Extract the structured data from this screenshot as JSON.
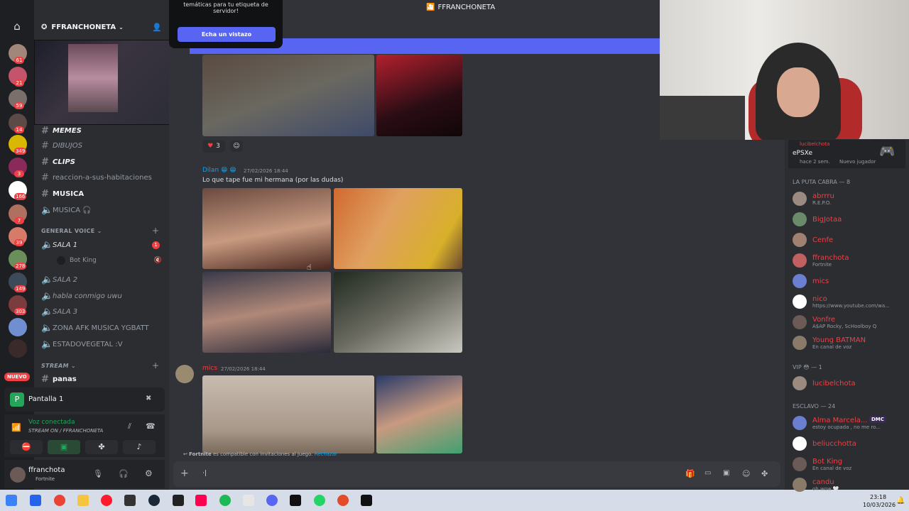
{
  "titlebar": {
    "title": "FFRANCHONETA"
  },
  "banner_popup": {
    "text": "temáticas para tu etiqueta de servidor!",
    "button": "Echa un vistazo"
  },
  "server": {
    "name": "FFRANCHONETA"
  },
  "rail_badges": [
    "61",
    "21",
    "59",
    "14",
    "349",
    "3",
    "166",
    "7",
    "39",
    "278",
    "149",
    "303"
  ],
  "channels": {
    "memes": "MEMES",
    "dibujos": "DIBUJOS",
    "clips": "CLIPS",
    "reaccion": "reaccion-a-sus-habitaciones",
    "musica": "MUSICA",
    "musica_voice": "MUSICA 🎧",
    "general_voice": "GENERAL VOICE",
    "sala1": "SALA 1",
    "sala1_badge": "1",
    "bot_king": "Bot King",
    "sala2": "SALA 2",
    "habla": "habla conmigo uwu",
    "sala3": "SALA 3",
    "zona": "ZONA AFK MUSICA YGBATT",
    "estado": "ESTADOVEGETAL :V",
    "stream_cat": "STREAM",
    "panas": "panas",
    "nuevo": "NUEVO"
  },
  "stream_panel": {
    "title": "Pantalla 1"
  },
  "voice": {
    "status": "Voz conectada",
    "sub": "STREAM ON / FFRANCHONETA"
  },
  "user": {
    "name": "ffranchota",
    "status": "Fortnite"
  },
  "messages": {
    "reaction_count": "3",
    "msg1_author": "Dilan 😁 😁",
    "msg1_time": "27/02/2026 18:44",
    "msg1_text": "Lo que tape fue mi hermana (por las dudas)",
    "msg2_author": "mics",
    "msg2_time": "27/02/2026 18:44"
  },
  "invite_bar": {
    "game": "Fortnite",
    "text": "es compatible con invitaciones al juego.",
    "action": "Rechazar"
  },
  "composer": {
    "value": "·|"
  },
  "activity": {
    "user": "lucibelchota",
    "game": "ePSXe",
    "when": "hace 2 sem.",
    "tag": "Nuevo jugador"
  },
  "members": {
    "group1": "LA PUTA CABRA — 8",
    "list1": [
      {
        "name": "abrrru",
        "sub": "R.E.P.O."
      },
      {
        "name": "BigJotaa",
        "sub": ""
      },
      {
        "name": "Cenfe",
        "sub": ""
      },
      {
        "name": "ffranchota",
        "sub": "Fortnite"
      },
      {
        "name": "mics",
        "sub": ""
      },
      {
        "name": "nico",
        "sub": "https://www.youtube.com/wa..."
      },
      {
        "name": "Vonfre",
        "sub": "A$AP Rocky, ScHoolboy Q"
      },
      {
        "name": "Young BATMAN",
        "sub": "En canal de voz"
      }
    ],
    "group2": "VIP 😳 — 1",
    "list2": [
      {
        "name": "lucibelchota",
        "sub": ""
      }
    ],
    "group3": "ESCLAVO — 24",
    "list3": [
      {
        "name": "Alma Marcela...",
        "sub": "estoy ocupada , no me ro..."
      },
      {
        "name": "beliucchotta",
        "sub": ""
      },
      {
        "name": "Bot King",
        "sub": "En canal de voz"
      },
      {
        "name": "candu",
        "sub": "oh wow 🤍"
      }
    ],
    "dmc": "DMC"
  },
  "clock": {
    "time": "23:18",
    "date": "10/03/2026"
  },
  "colors": {
    "accent": "#5865f2",
    "mention": "#f23f43",
    "online": "#23a55a",
    "link": "#00a8fc"
  }
}
